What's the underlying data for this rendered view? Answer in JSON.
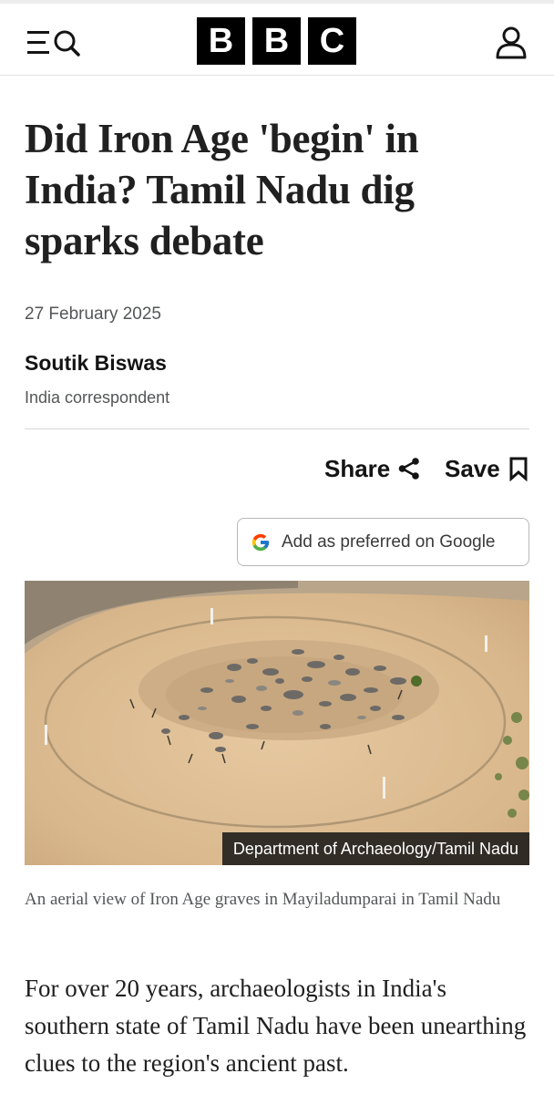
{
  "header": {
    "logo_letters": [
      "B",
      "B",
      "C"
    ],
    "menu_icon": "menu-icon",
    "search_icon": "search-icon",
    "account_icon": "account-icon"
  },
  "article": {
    "headline": "Did Iron Age 'begin' in India? Tamil Nadu dig sparks debate",
    "date": "27 February 2025",
    "author": "Soutik Biswas",
    "author_role": "India correspondent",
    "share_label": "Share",
    "save_label": "Save",
    "google_button_label": "Add as preferred on Google",
    "image_credit": "Department of Archaeology/Tamil Nadu",
    "image_caption": "An aerial view of Iron Age graves in Mayiladumparai in Tamil Nadu",
    "first_paragraph": "For over 20 years, archaeologists in India's southern state of Tamil Nadu have been unearthing clues to the region's ancient past."
  },
  "colors": {
    "brand_black": "#000000",
    "text_secondary": "#545658"
  }
}
